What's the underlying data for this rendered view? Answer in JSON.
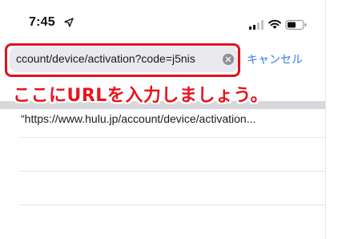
{
  "status_bar": {
    "time": "7:45",
    "icons": [
      "location-arrow-icon",
      "signal-icon",
      "wifi-icon",
      "battery-icon"
    ]
  },
  "address_bar": {
    "url_value": "ccount/device/activation?code=j5nis",
    "cancel_label": "キャンセル",
    "clear_icon": "clear-icon"
  },
  "annotation": {
    "callout_text": "ここにURLを入力しましょう。",
    "highlight_color": "#e0121f"
  },
  "suggestions": [
    {
      "label": "“https://www.hulu.jp/account/device/activation..."
    }
  ],
  "colors": {
    "accent": "#2f7df6",
    "callout": "#e8141d"
  }
}
